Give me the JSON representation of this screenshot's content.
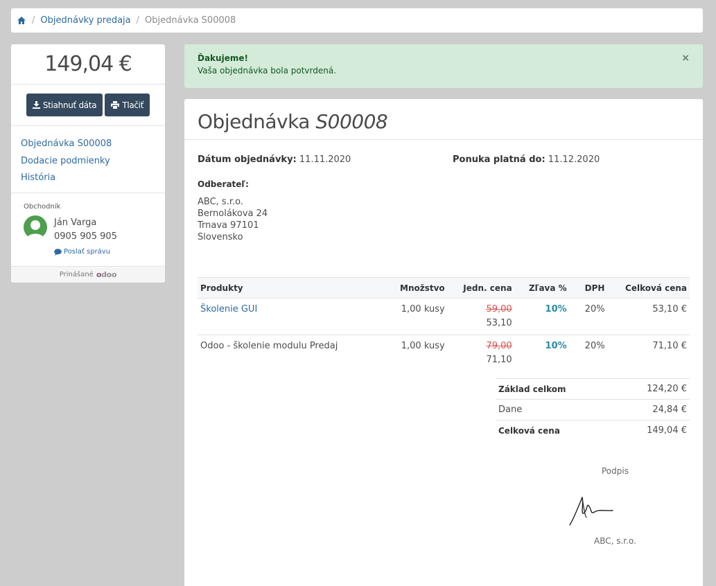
{
  "breadcrumb": {
    "home_icon": "home-icon",
    "items": [
      "Objednávky predaja",
      "Objednávka S00008"
    ]
  },
  "sidebar": {
    "amount": "149,04 €",
    "download_label": "Stiahnuť dáta",
    "print_label": "Tlačiť",
    "nav": [
      "Objednávka S00008",
      "Dodacie podmienky",
      "História"
    ],
    "salesperson": {
      "header": "Obchodník",
      "name": "Ján Varga",
      "phone": "0905 905 905",
      "message_label": "Poslať správu"
    },
    "powered_by": "Prinášané",
    "brand": "odoo"
  },
  "alert": {
    "title": "Ďakujeme!",
    "text": "Vaša objednávka bola potvrdená.",
    "close": "×"
  },
  "order": {
    "title_prefix": "Objednávka",
    "number": "S00008",
    "date_label": "Dátum objednávky:",
    "date": "11.11.2020",
    "valid_label": "Ponuka platná do:",
    "valid": "11.12.2020",
    "customer_label": "Odberateľ:",
    "address": [
      "ABC, s.r.o.",
      "Bernolákova 24",
      "Trnava 97101",
      "Slovensko"
    ],
    "columns": [
      "Produkty",
      "Množstvo",
      "Jedn. cena",
      "Zľava %",
      "DPH",
      "Celková cena"
    ],
    "lines": [
      {
        "product": "Školenie GUI",
        "qty": "1,00 kusy",
        "old_price": "59,00",
        "price": "53,10",
        "discount": "10%",
        "tax": "20%",
        "total": "53,10 €"
      },
      {
        "product": "Odoo - školenie modulu Predaj",
        "qty": "1,00 kusy",
        "old_price": "79,00",
        "price": "71,10",
        "discount": "10%",
        "tax": "20%",
        "total": "71,10 €"
      }
    ],
    "totals": [
      {
        "label": "Základ celkom",
        "value": "124,20 €"
      },
      {
        "label": "Dane",
        "value": "24,84 €"
      },
      {
        "label": "Celková cena",
        "value": "149,04 €"
      }
    ],
    "signature_label": "Podpis",
    "signed_by": "ABC, s.r.o."
  }
}
